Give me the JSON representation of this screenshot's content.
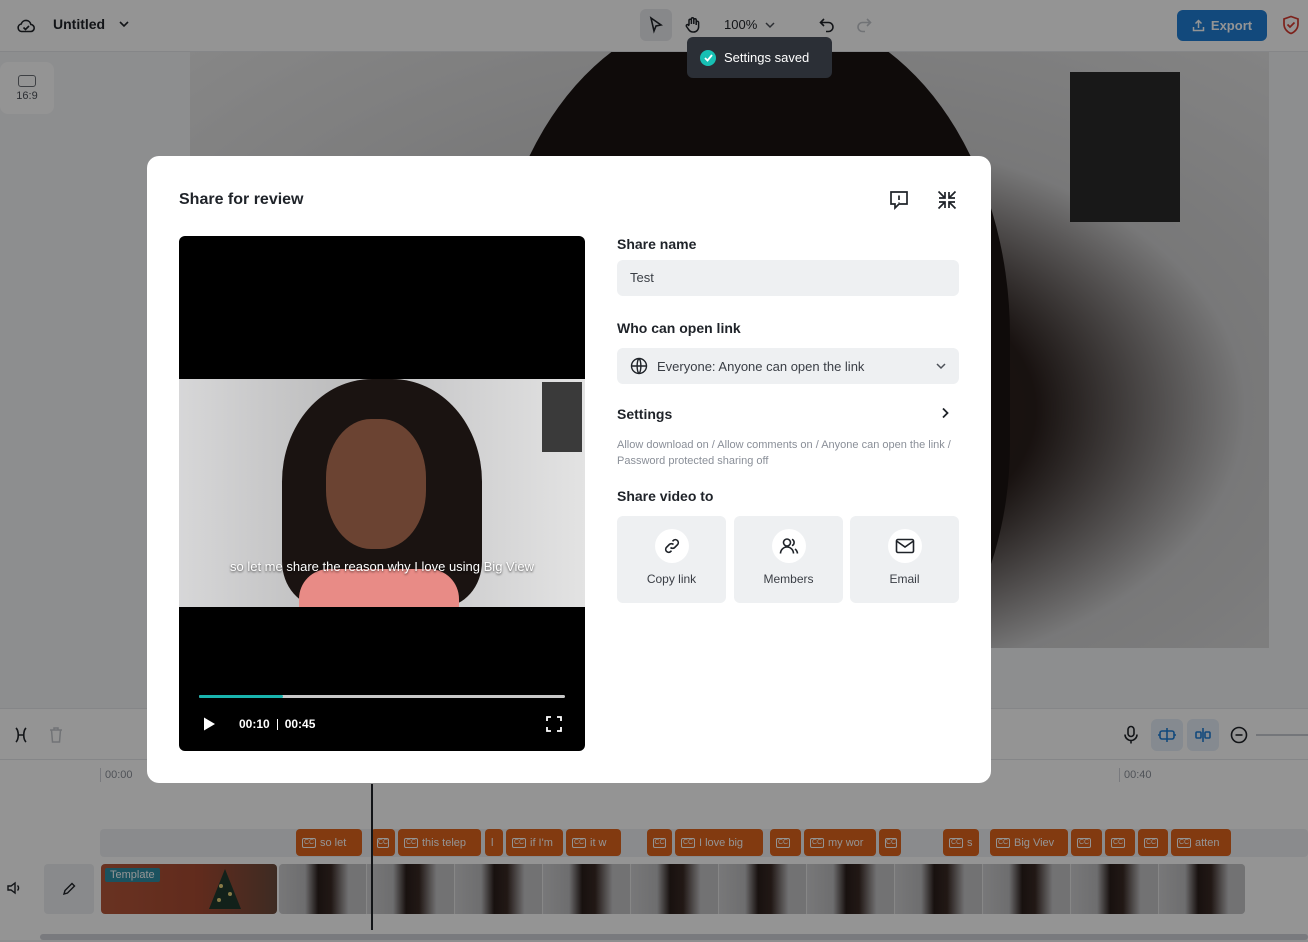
{
  "header": {
    "project_title": "Untitled",
    "zoom": "100%",
    "export_label": "Export"
  },
  "left_panel": {
    "ratio_label": "16:9"
  },
  "toast": {
    "message": "Settings saved"
  },
  "timeline": {
    "ruler_ticks": [
      "00:00",
      "00:40"
    ],
    "template_label": "Template",
    "captions": [
      "so let",
      "this telep",
      "l",
      "if I'm",
      "it w",
      "",
      "I love big",
      "",
      "my wor",
      "",
      "s",
      "Big Viev",
      "",
      "",
      "",
      "atten"
    ]
  },
  "modal": {
    "title": "Share for review",
    "share_name_label": "Share name",
    "share_name_value": "Test",
    "who_can_open_label": "Who can open link",
    "who_can_open_value": "Everyone: Anyone can open the link",
    "settings_label": "Settings",
    "settings_description": "Allow download on / Allow comments on / Anyone can open the link / Password protected sharing off",
    "share_video_to_label": "Share video to",
    "share_options": [
      {
        "label": "Copy link",
        "icon": "link-icon"
      },
      {
        "label": "Members",
        "icon": "members-icon"
      },
      {
        "label": "Email",
        "icon": "email-icon"
      }
    ]
  },
  "player": {
    "subtitle": "so let me share the reason why I love using Big View",
    "current_time": "00:10",
    "duration": "00:45",
    "progress": 0.23
  },
  "colors": {
    "accent_teal": "#19b4ae",
    "export_blue": "#1f7ed6",
    "caption_orange": "#e0641c"
  }
}
